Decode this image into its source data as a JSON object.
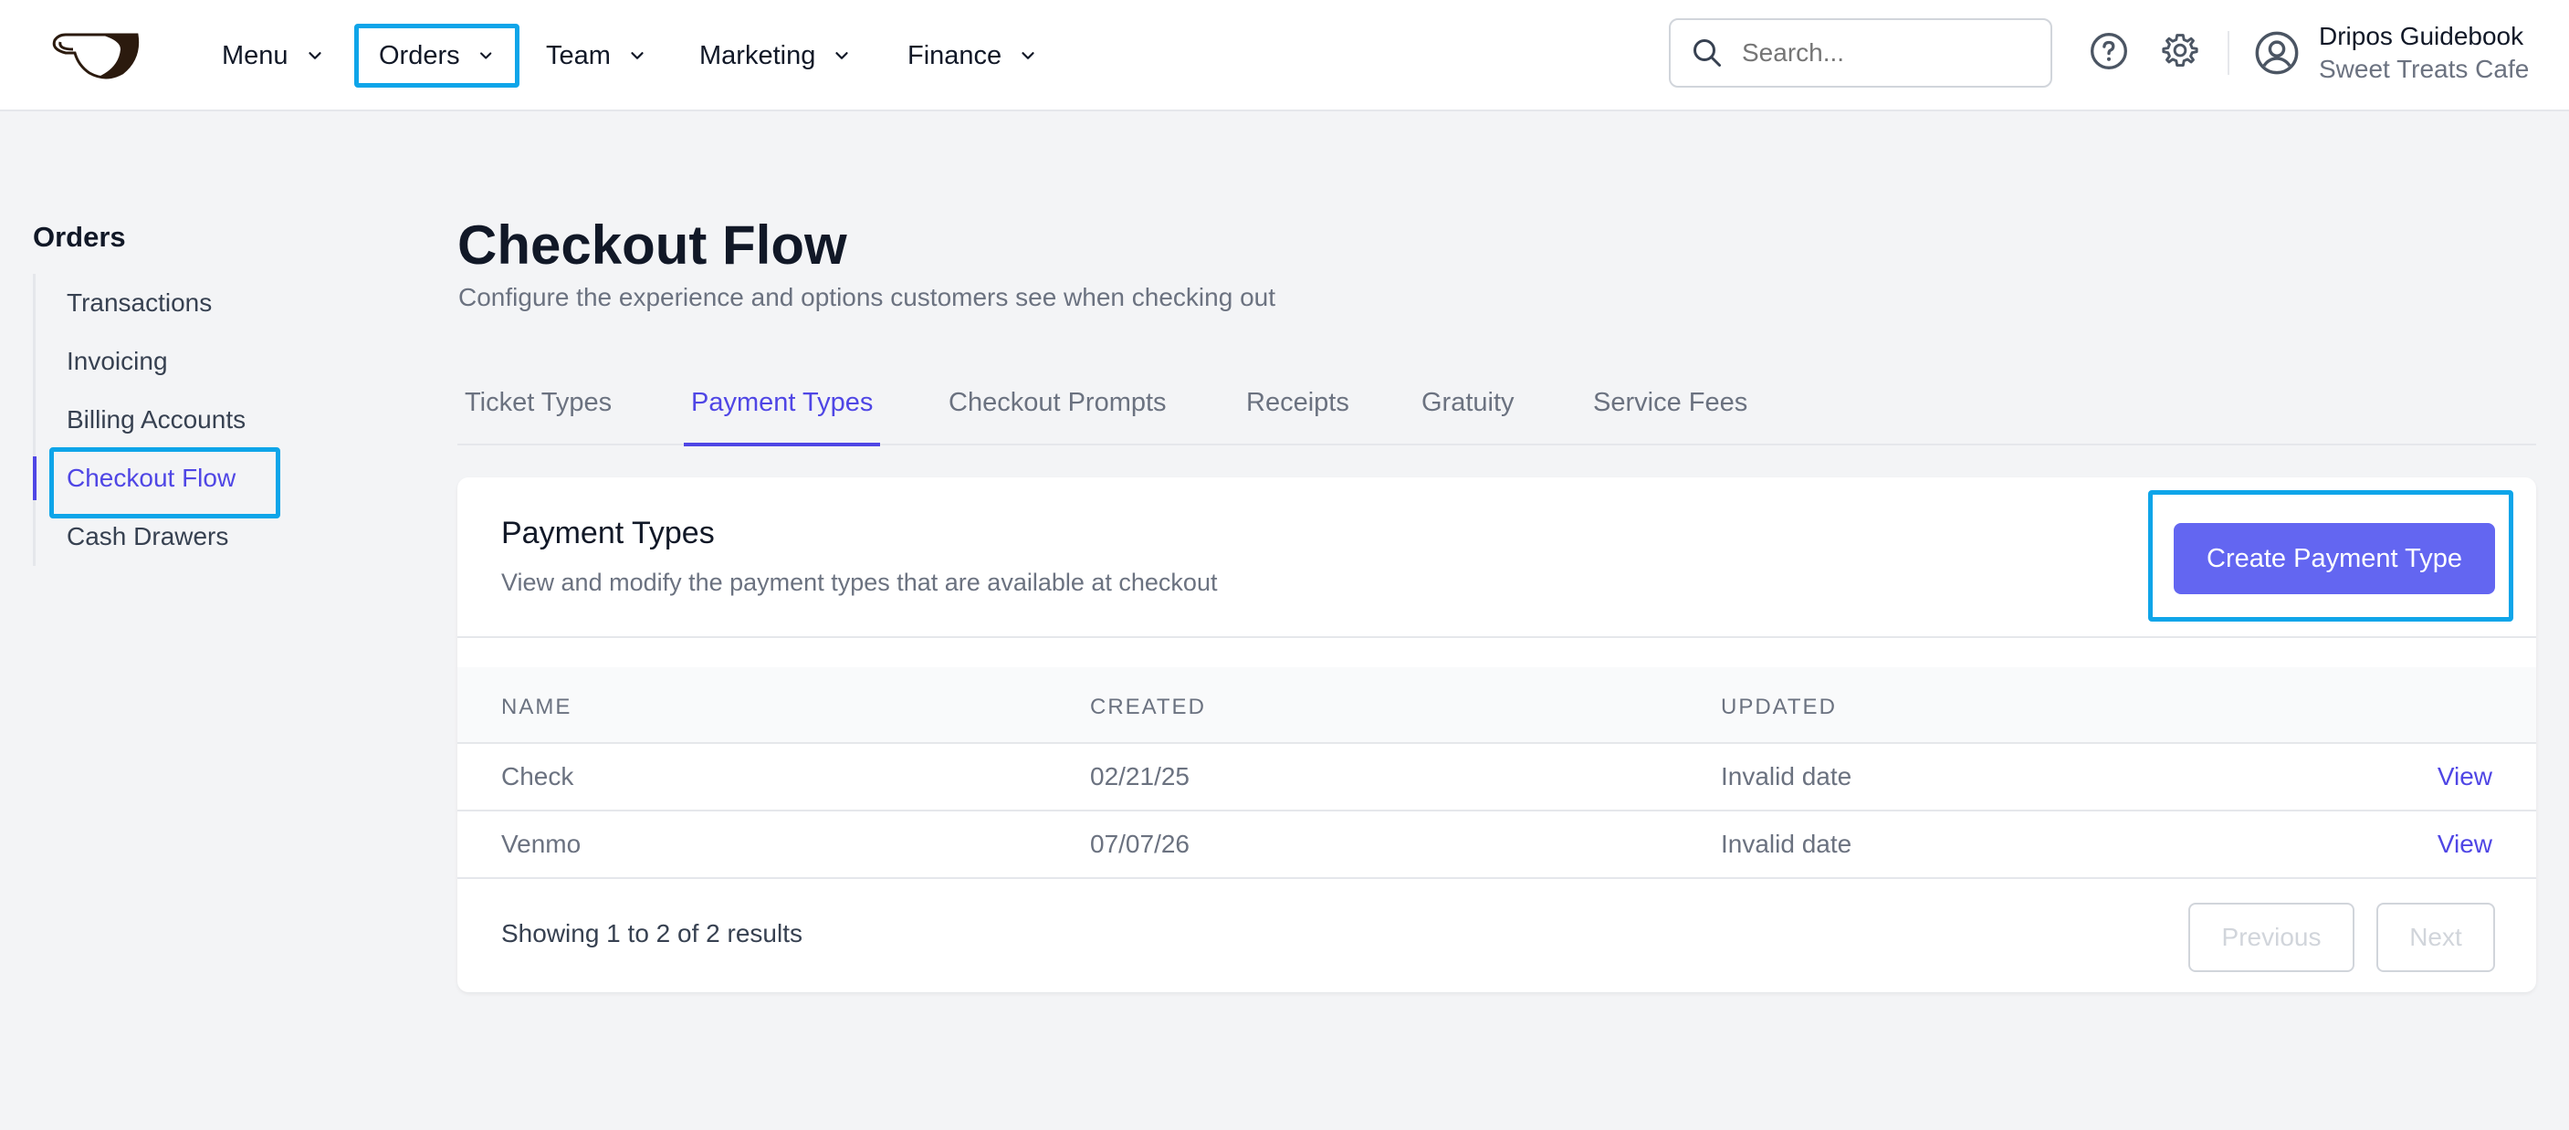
{
  "nav": {
    "items": [
      {
        "label": "Menu"
      },
      {
        "label": "Orders"
      },
      {
        "label": "Team"
      },
      {
        "label": "Marketing"
      },
      {
        "label": "Finance"
      }
    ],
    "search_placeholder": "Search...",
    "user_name": "Dripos Guidebook",
    "user_business": "Sweet Treats Cafe"
  },
  "sidebar": {
    "title": "Orders",
    "items": [
      {
        "label": "Transactions"
      },
      {
        "label": "Invoicing"
      },
      {
        "label": "Billing Accounts"
      },
      {
        "label": "Checkout Flow",
        "active": true
      },
      {
        "label": "Cash Drawers"
      }
    ]
  },
  "page": {
    "title": "Checkout Flow",
    "subtitle": "Configure the experience and options customers see when checking out"
  },
  "tabs": [
    {
      "label": "Ticket Types"
    },
    {
      "label": "Payment Types",
      "active": true
    },
    {
      "label": "Checkout Prompts"
    },
    {
      "label": "Receipts"
    },
    {
      "label": "Gratuity"
    },
    {
      "label": "Service Fees"
    }
  ],
  "card": {
    "title": "Payment Types",
    "description": "View and modify the payment types that are available at checkout",
    "create_button": "Create Payment Type"
  },
  "table": {
    "headers": [
      "NAME",
      "CREATED",
      "UPDATED"
    ],
    "rows": [
      {
        "name": "Check",
        "created": "02/21/25",
        "updated": "Invalid date",
        "action": "View"
      },
      {
        "name": "Venmo",
        "created": "07/07/26",
        "updated": "Invalid date",
        "action": "View"
      }
    ]
  },
  "pagination": {
    "summary": "Showing 1 to 2 of 2 results",
    "previous": "Previous",
    "next": "Next"
  },
  "colors": {
    "accent": "#4f46e5",
    "button": "#6366f1",
    "highlight": "#0ea5e9",
    "background": "#f3f4f6"
  },
  "icons": [
    "cup-logo-icon",
    "chevron-down-icon",
    "search-icon",
    "help-icon",
    "gear-icon",
    "user-circle-icon"
  ]
}
